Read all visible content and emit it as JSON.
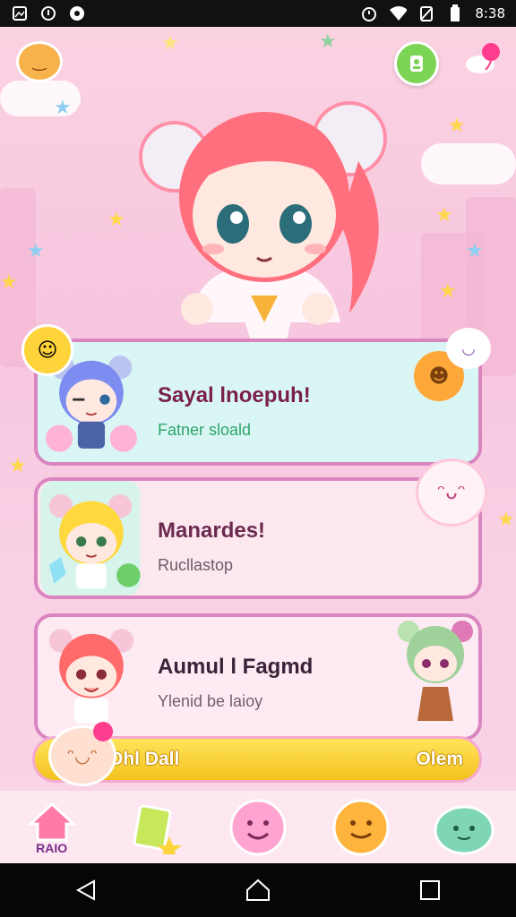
{
  "status_bar": {
    "time": "8:38",
    "icons": [
      "image-icon",
      "record-icon",
      "download-icon",
      "alarm-icon",
      "wifi-icon",
      "no-sim-icon",
      "battery-icon"
    ]
  },
  "cards": [
    {
      "title": "Sayal lnoepuh!",
      "subtitle": "Fatner sloald",
      "avatar": "blue-hair-girl"
    },
    {
      "title": "Manardes!",
      "subtitle": "Rucllastop",
      "avatar": "blonde-girl"
    },
    {
      "title": "Aumul l Fagmd",
      "subtitle": "Ylenid be laioy",
      "avatar": "red-hair-girl"
    }
  ],
  "bottom_bar": {
    "left_label": "Ohl Dall",
    "right_label": "Olem"
  },
  "bottom_nav": {
    "home_label": "RAIO"
  },
  "colors": {
    "background": "#f8cde2",
    "card_border": "#d985c0",
    "accent_yellow": "#f6cf2a",
    "green_button": "#7bd454"
  }
}
